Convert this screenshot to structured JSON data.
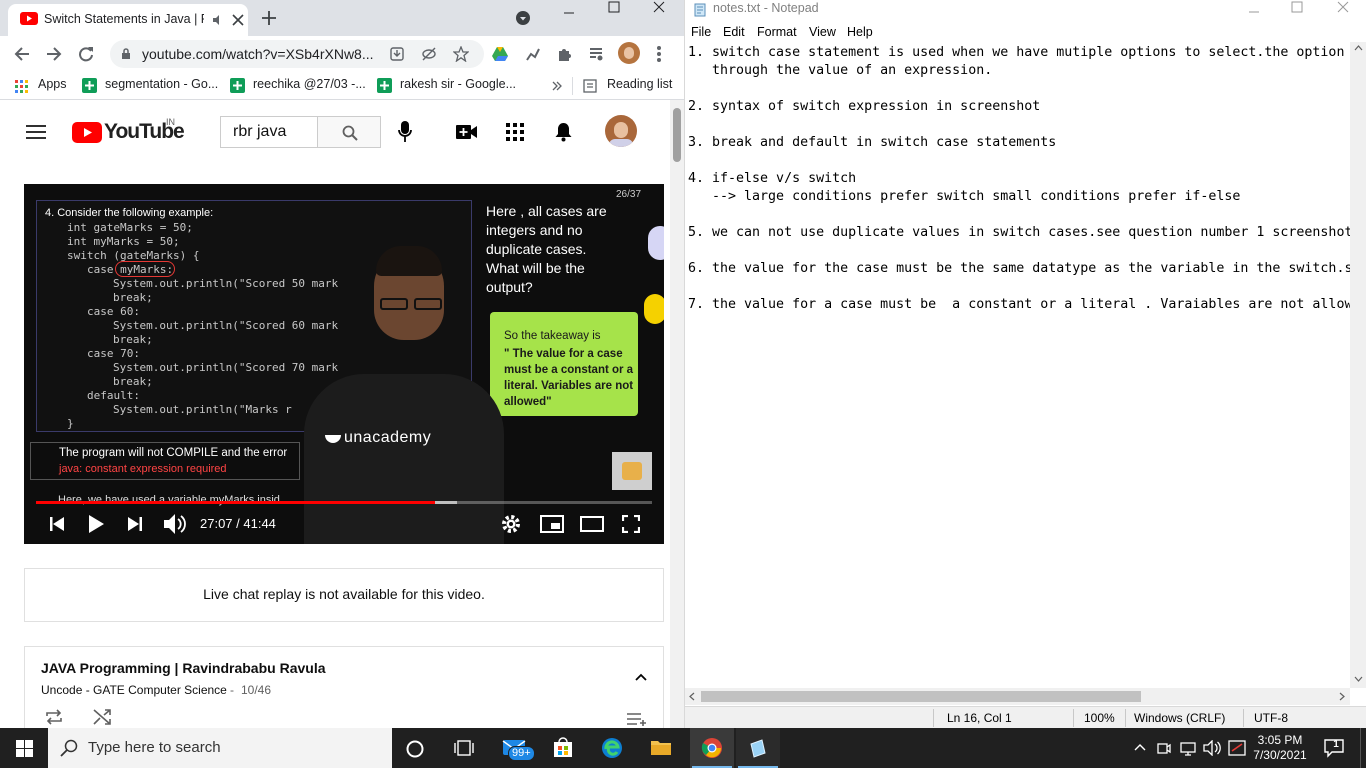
{
  "chrome": {
    "tab_title": "Switch Statements in Java | R",
    "url": "youtube.com/watch?v=XSb4rXNw8...",
    "bookmarks": [
      "Apps",
      "segmentation - Go...",
      "reechika @27/03 -...",
      "rakesh sir - Google...",
      "Reading list"
    ],
    "youtube": {
      "logo_text": "YouTube",
      "country": "IN",
      "search_value": "rbr java"
    },
    "video": {
      "slide_counter": "26/37",
      "question": "4. Consider the following example:",
      "code_lines": [
        "int gateMarks = 50;",
        "int myMarks = 50;",
        "switch (gateMarks) {",
        "case myMarks:",
        "System.out.println(\"Scored 50 mark",
        "break;",
        "case 60:",
        "System.out.println(\"Scored 60 mark",
        "break;",
        "case 70:",
        "System.out.println(\"Scored 70 mark",
        "break;",
        "default:",
        "System.out.println(\"Marks r",
        "}"
      ],
      "right_text": "Here , all cases are integers and no duplicate cases. What will be the output?",
      "takeaway_intro": "So the takeaway is",
      "takeaway_quote": "\" The value for a case must be a constant or a literal. Variables are not allowed\"",
      "compile_line": "The program will not COMPILE and the error",
      "error_line": "java: constant expression required",
      "caption": "Here, we have used a variable myMarks insid",
      "watermark": "unacademy",
      "time": "27:07 / 41:44",
      "progress": 0.647
    },
    "live_chat": "Live chat replay is not available for this video.",
    "playlist": {
      "title": "JAVA Programming | Ravindrababu Ravula",
      "channel": "Uncode - GATE Computer Science",
      "position": "10/46"
    }
  },
  "notepad": {
    "title": "notes.txt - Notepad",
    "menu": [
      "File",
      "Edit",
      "Format",
      "View",
      "Help"
    ],
    "lines": [
      "1. switch case statement is used when we have mutiple options to select.the option",
      "   through the value of an expression.",
      "",
      "2. syntax of switch expression in screenshot",
      "",
      "3. break and default in switch case statements",
      "",
      "4. if-else v/s switch",
      "   --> large conditions prefer switch small conditions prefer if-else",
      "",
      "5. we can not use duplicate values in switch cases.see question number 1 screenshot",
      "",
      "6. the value for the case must be the same datatype as the variable in the switch.s",
      "",
      "7. the value for a case must be  a constant or a literal . Varaiables are not allow"
    ],
    "status": {
      "position": "Ln 16, Col 1",
      "zoom": "100%",
      "line_endings": "Windows (CRLF)",
      "encoding": "UTF-8"
    }
  },
  "taskbar": {
    "search_placeholder": "Type here to search",
    "mail_badge": "99+",
    "time": "3:05 PM",
    "date": "7/30/2021",
    "notification_count": "1"
  },
  "colors": {
    "youtube_red": "#ff0000",
    "chrome_tab_strip": "#dee1e6",
    "takeaway_green": "#a6e34a",
    "taskbar": "#202020"
  }
}
